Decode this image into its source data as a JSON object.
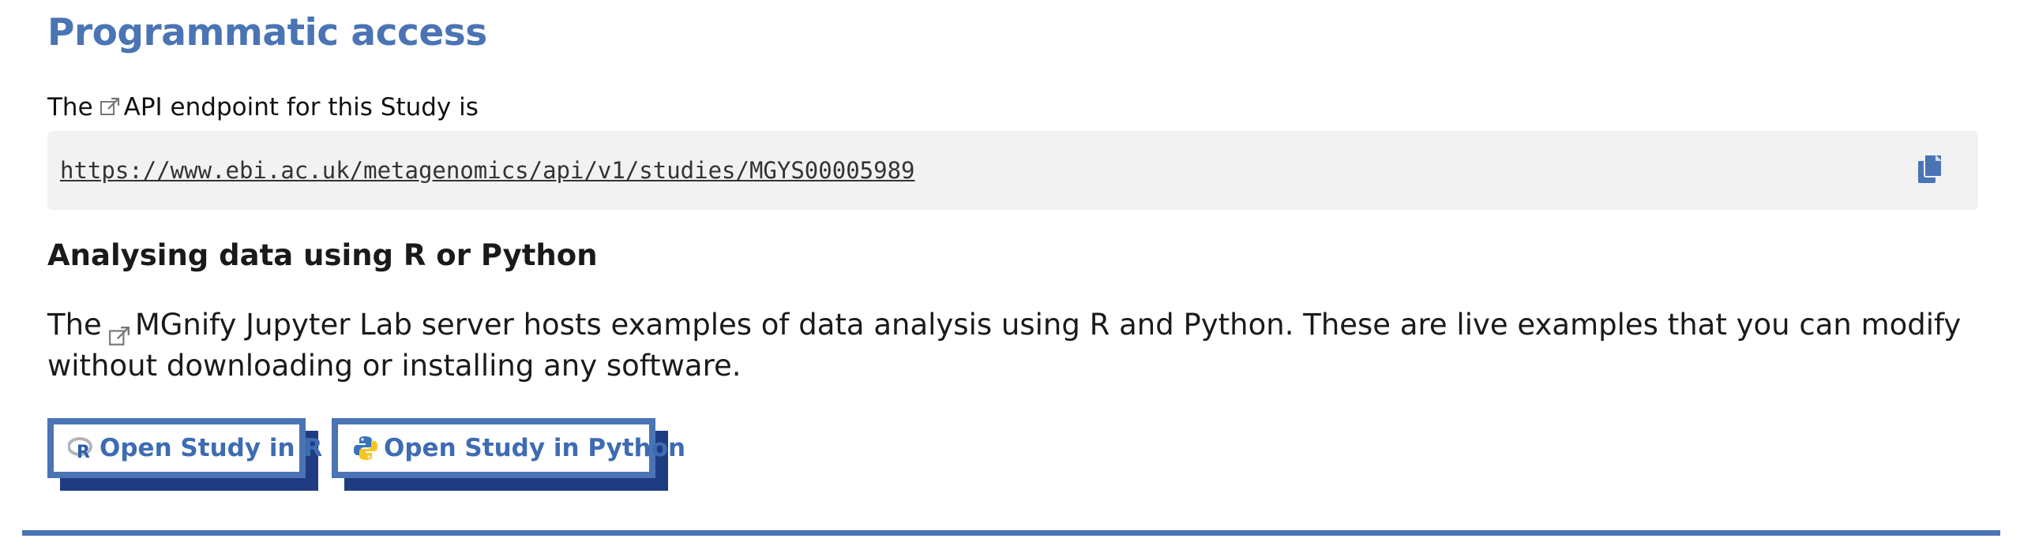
{
  "section": {
    "title": "Programmatic access"
  },
  "api": {
    "prefix": "The",
    "link_text": "API endpoint for this Study is",
    "url": "https://www.ebi.ac.uk/metagenomics/api/v1/studies/MGYS00005989",
    "copy_icon": "copy-icon"
  },
  "analysis": {
    "heading": "Analysing data using R or Python",
    "prefix": "The",
    "link_text": "MGnify Jupyter Lab server hosts examples of data analysis using R and Python. These are live examples that you can modify without downloading or installing any software."
  },
  "buttons": {
    "r_label": "Open Study in R",
    "python_label": "Open Study in Python"
  },
  "colors": {
    "accent": "#4a74b4",
    "button_shadow": "#1f3b82",
    "code_bg": "#f2f2f2"
  },
  "icons": {
    "external": "external-link-icon",
    "r": "r-logo-icon",
    "python": "python-logo-icon"
  }
}
